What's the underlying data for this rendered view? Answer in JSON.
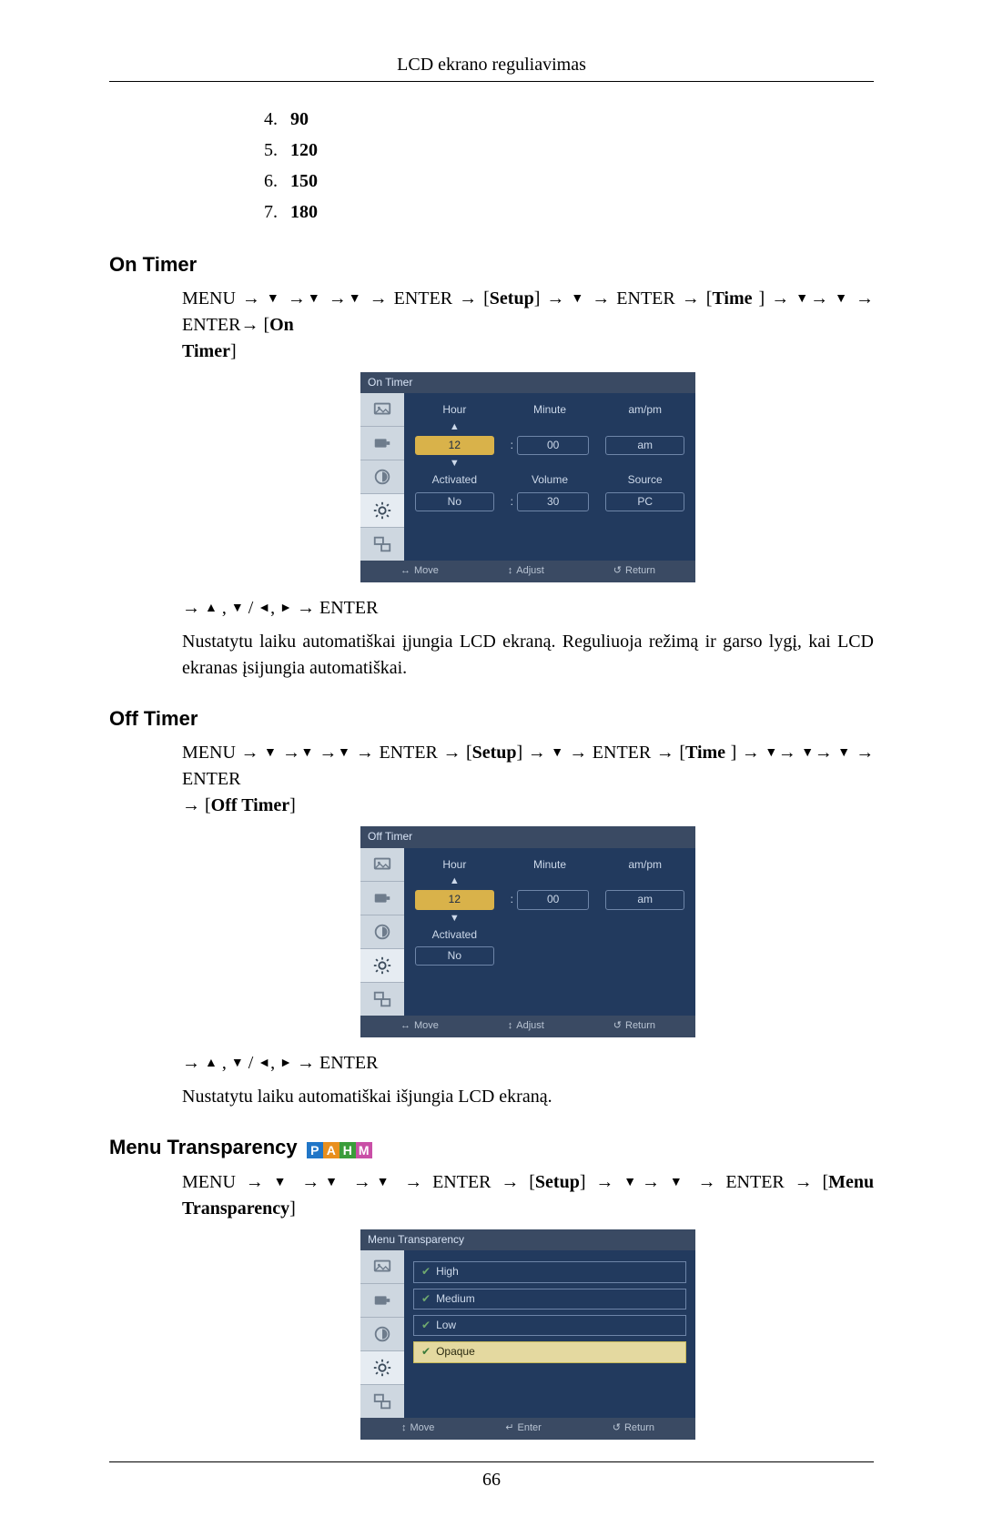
{
  "header": {
    "title": "LCD ekrano reguliavimas"
  },
  "numbered_list": [
    {
      "n": "4.",
      "v": "90"
    },
    {
      "n": "5.",
      "v": "120"
    },
    {
      "n": "6.",
      "v": "150"
    },
    {
      "n": "7.",
      "v": "180"
    }
  ],
  "sections": {
    "on_timer": {
      "heading": "On Timer",
      "nav_menu": "MENU",
      "nav_enter": "ENTER",
      "setup": "Setup",
      "time": "Time",
      "target_open": "On",
      "target_close": "Timer",
      "post_nav_enter": "ENTER",
      "desc": "Nustatytu laiku automatiškai įjungia LCD ekraną. Reguliuoja režimą ir garso lygį, kai LCD ekranas įsijungia automatiškai.",
      "osd": {
        "title": "On Timer",
        "cols": [
          "Hour",
          "Minute",
          "am/pm"
        ],
        "row1": [
          "12",
          "00",
          "am"
        ],
        "cols2": [
          "Activated",
          "Volume",
          "Source"
        ],
        "row2": [
          "No",
          "30",
          "PC"
        ],
        "footer": [
          "Move",
          "Adjust",
          "Return"
        ]
      }
    },
    "off_timer": {
      "heading": "Off Timer",
      "nav_menu": "MENU",
      "nav_enter": "ENTER",
      "setup": "Setup",
      "time": "Time",
      "target": "Off Timer",
      "post_nav_enter": "ENTER",
      "desc": "Nustatytu laiku automatiškai išjungia LCD ekraną.",
      "osd": {
        "title": "Off Timer",
        "cols": [
          "Hour",
          "Minute",
          "am/pm"
        ],
        "row1": [
          "12",
          "00",
          "am"
        ],
        "cols2_single": "Activated",
        "row2_single": "No",
        "footer": [
          "Move",
          "Adjust",
          "Return"
        ]
      }
    },
    "menu_transparency": {
      "heading": "Menu Transparency",
      "badges": [
        "P",
        "A",
        "H",
        "M"
      ],
      "nav_menu": "MENU",
      "nav_enter": "ENTER",
      "setup": "Setup",
      "target": "Menu Transparency",
      "osd": {
        "title": "Menu Transparency",
        "items": [
          "High",
          "Medium",
          "Low",
          "Opaque"
        ],
        "selected": "Opaque",
        "footer": [
          "Move",
          "Enter",
          "Return"
        ]
      }
    }
  },
  "symbols": {
    "arrow_right": "→",
    "tri_down": "▼",
    "tri_up": "▲",
    "tri_left": "◄",
    "tri_right": "►",
    "slash": "/",
    "comma": ",",
    "updown": "↕",
    "leftright": "↔",
    "return": "↺",
    "enter_glyph": "↵"
  },
  "page_number": "66"
}
